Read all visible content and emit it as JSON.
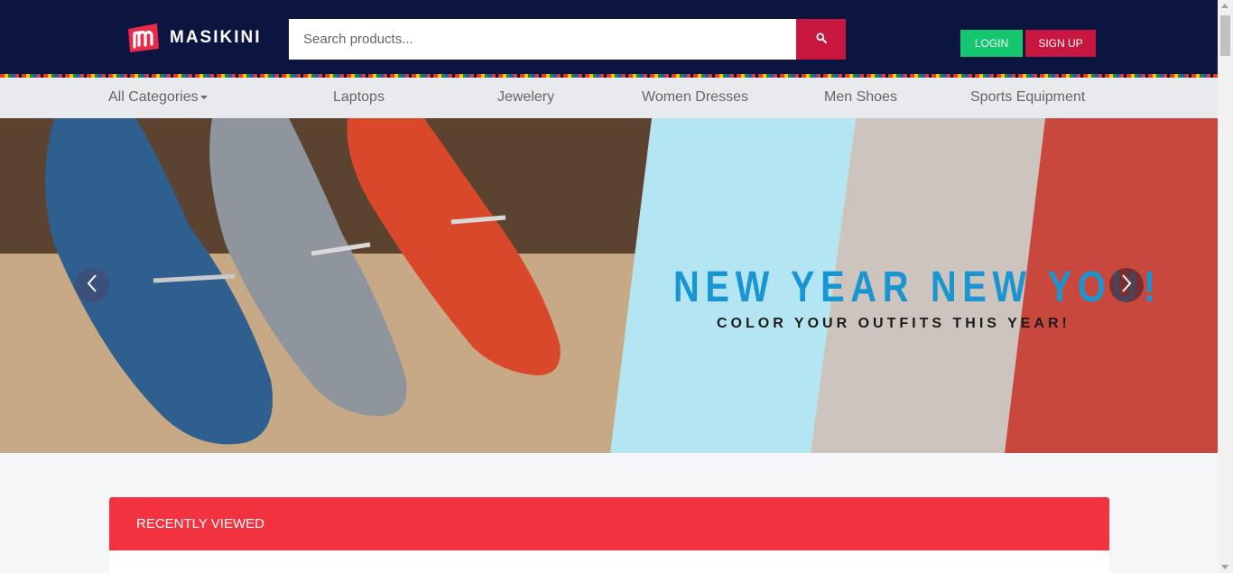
{
  "header": {
    "logo_text": "MASIKINI",
    "search_placeholder": "Search products...",
    "login_label": "LOGIN",
    "signup_label": "SIGN UP"
  },
  "nav": {
    "items": [
      {
        "label": "All Categories"
      },
      {
        "label": "Laptops"
      },
      {
        "label": "Jewelery"
      },
      {
        "label": "Women Dresses"
      },
      {
        "label": "Men Shoes"
      },
      {
        "label": "Sports Equipment"
      }
    ]
  },
  "hero": {
    "title": "NEW YEAR NEW YOU!",
    "subtitle": "COLOR YOUR OUTFITS THIS YEAR!"
  },
  "recently_viewed": {
    "title": "RECENTLY VIEWED"
  },
  "colors": {
    "header_bg": "#0c1440",
    "brand_red": "#c8173f",
    "login_green": "#14c66d",
    "hero_title_blue": "#1996d1",
    "recently_viewed_red": "#f3323f"
  },
  "icons": [
    "logo-icon",
    "search-icon",
    "caret-down-icon",
    "chevron-left-icon",
    "chevron-right-icon"
  ]
}
